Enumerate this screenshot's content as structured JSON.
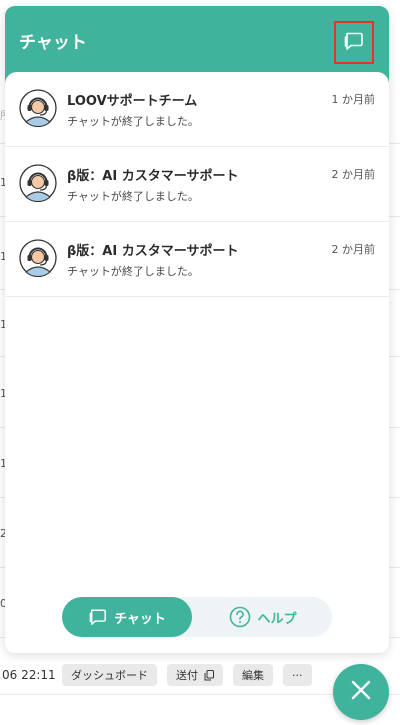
{
  "background": {
    "fragments": [
      "所",
      "1",
      "1",
      "1",
      "1",
      "1",
      "2",
      "0"
    ],
    "bottom_row": {
      "datetime": "06 22:11",
      "chips": [
        "ダッシュボード",
        "送付",
        "編集",
        "···"
      ]
    }
  },
  "widget": {
    "title": "チャット",
    "conversations": [
      {
        "name": "LOOVサポートチーム",
        "preview": "チャットが終了しました。",
        "time": "1 か月前"
      },
      {
        "name": "β版：AI カスタマーサポート",
        "preview": "チャットが終了しました。",
        "time": "2 か月前"
      },
      {
        "name": "β版：AI カスタマーサポート",
        "preview": "チャットが終了しました。",
        "time": "2 か月前"
      }
    ],
    "tabs": {
      "chat": "チャット",
      "help": "ヘルプ"
    }
  },
  "colors": {
    "accent": "#3fb39c",
    "highlight": "#e5352a"
  },
  "icons": {
    "new_chat": "chat-bubble-icon",
    "close": "close-icon",
    "help": "question-circle-icon",
    "copy": "copy-icon"
  }
}
